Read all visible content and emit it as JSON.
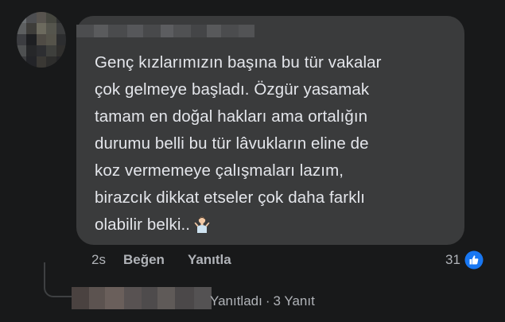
{
  "comment": {
    "lines": [
      "Genç kızlarımızın başına bu tür vakalar",
      "çok gelmeye başladı. Özgür yasamak",
      "tamam en doğal hakları ama ortalığın",
      "durumu belli bu tür lâvukların eline de",
      "koz vermemeye çalışmaları lazım,",
      "birazcık dikkat etseler çok daha farklı",
      "olabilir belki.."
    ],
    "emoji": "shrug-man-icon"
  },
  "meta": {
    "time": "2s",
    "like_label": "Beğen",
    "reply_label": "Yanıtla"
  },
  "reactions": {
    "count": "31",
    "icon": "like-icon",
    "color": "#2d88ff"
  },
  "reply_thread": {
    "replied_label": "Yanıtladı",
    "separator": "·",
    "replies_count": "3 Yanıt"
  },
  "colors": {
    "background": "#18191a",
    "bubble": "#3a3b3c",
    "text": "#e4e6eb",
    "secondary": "#b0b3b8"
  }
}
